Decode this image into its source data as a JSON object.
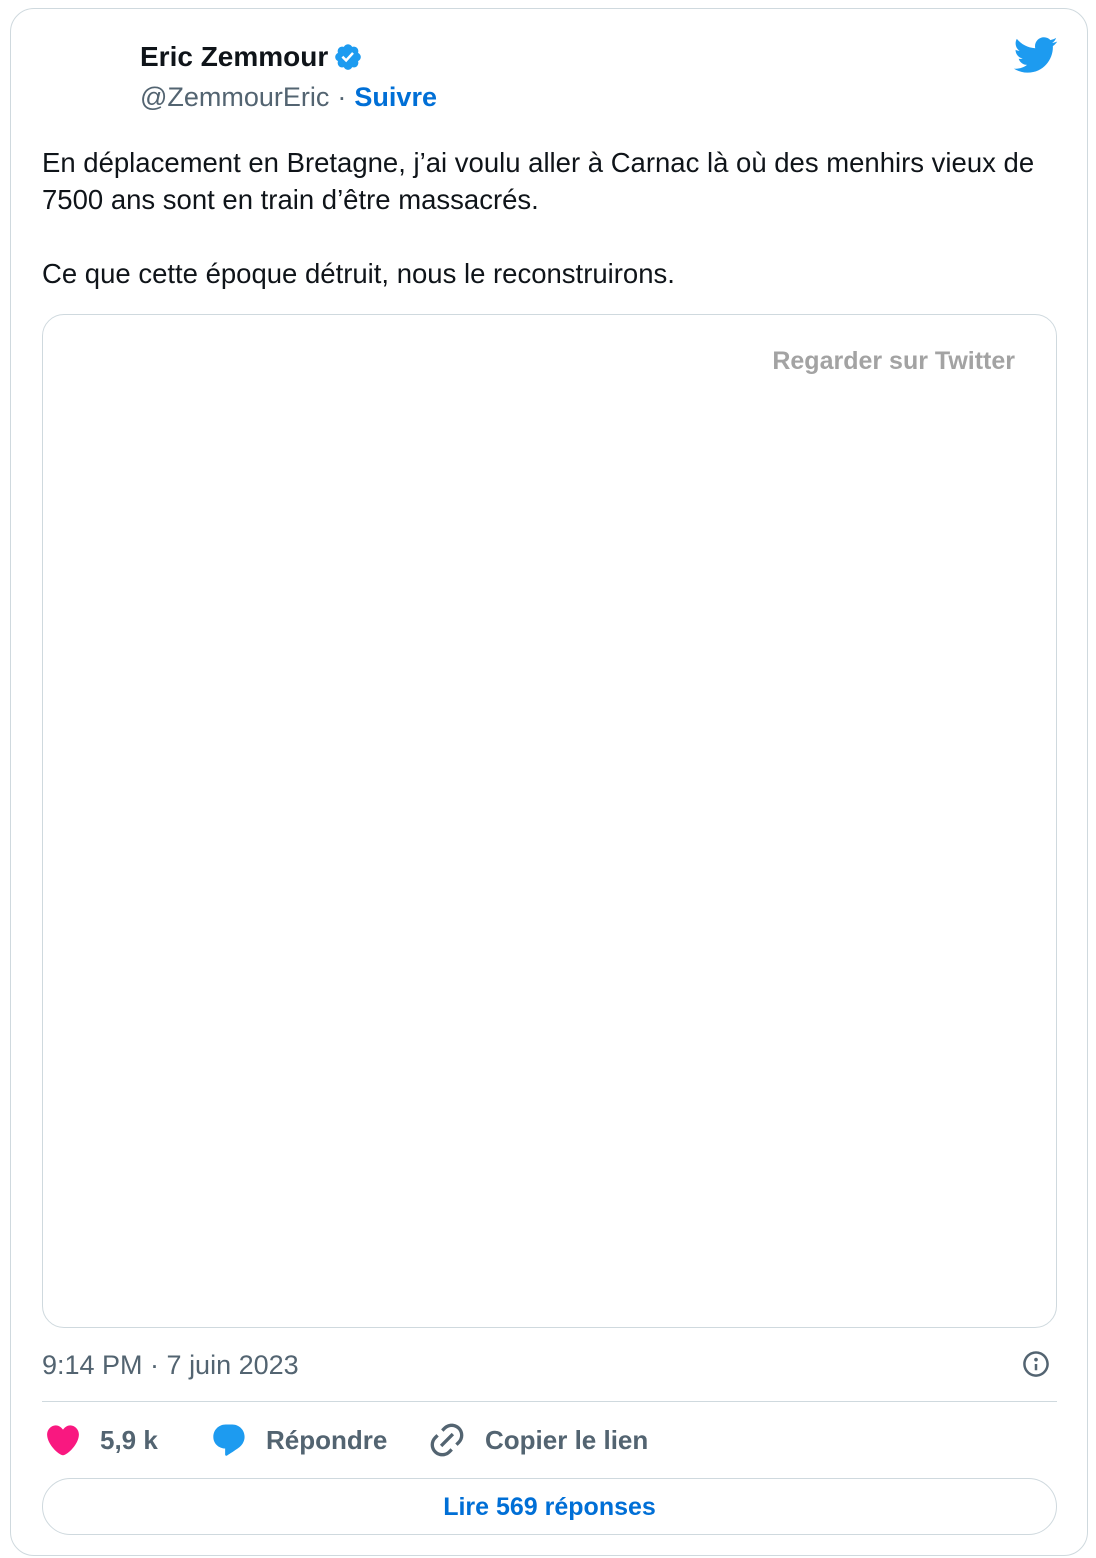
{
  "tweet": {
    "author": {
      "name": "Eric Zemmour",
      "handle": "@ZemmourEric",
      "verified": true
    },
    "separator": "·",
    "follow_label": "Suivre",
    "paragraphs": [
      "En déplacement en Bretagne, j’ai voulu aller à Carnac là où des menhirs vieux de 7500 ans sont en train d’être massacrés.",
      "Ce que cette époque détruit, nous le reconstruirons."
    ],
    "media": {
      "watch_label": "Regarder sur Twitter"
    },
    "timestamp": "9:14 PM · 7 juin 2023",
    "actions": {
      "likes": "5,9 k",
      "reply_label": "Répondre",
      "copy_link_label": "Copier le lien"
    },
    "read_replies_label": "Lire 569 réponses"
  },
  "icons": {
    "badge": "verified-badge-icon",
    "logo": "twitter-bird-icon",
    "info": "info-icon",
    "like": "heart-icon",
    "reply": "reply-bubble-icon",
    "copy_link": "link-icon"
  },
  "colors": {
    "text_primary": "#0f1419",
    "text_secondary": "#536471",
    "link_blue": "#006fd6",
    "twitter_blue": "#1d9bf0",
    "like_pink": "#f91880",
    "border": "#cfd9de",
    "watch_label": "#a3a3a3"
  }
}
